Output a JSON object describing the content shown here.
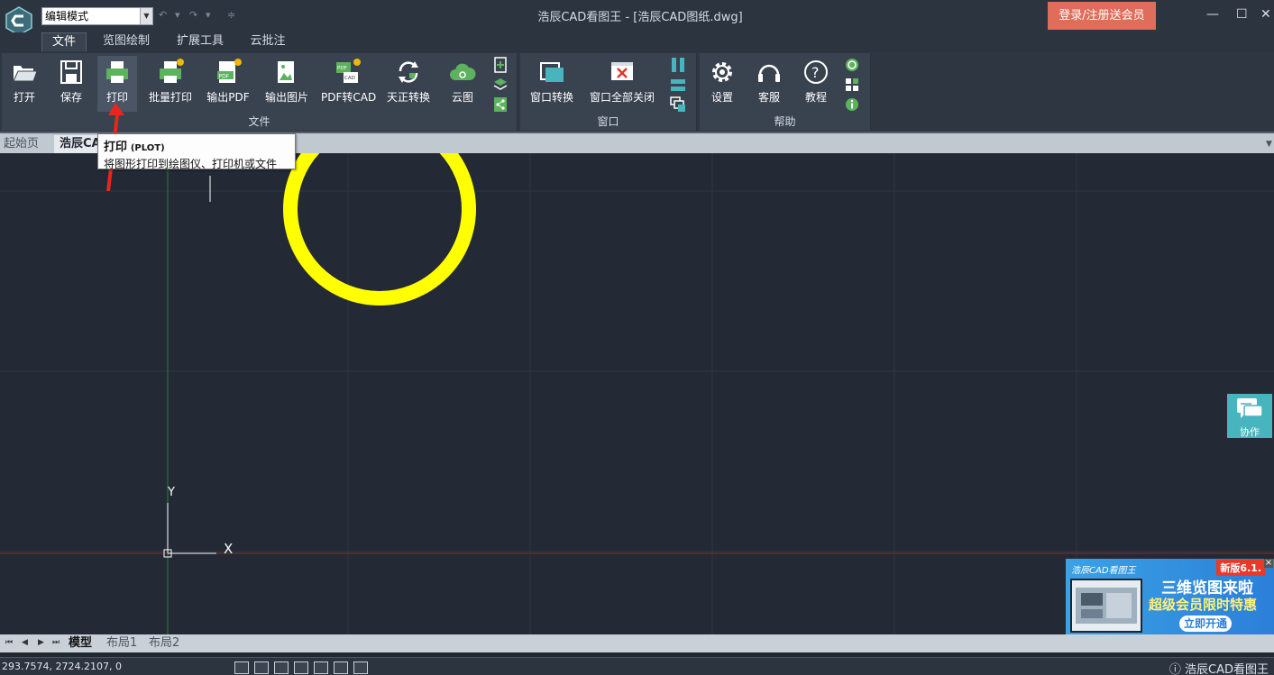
{
  "titlebar": {
    "mode_select": "编辑模式",
    "window_title": "浩辰CAD看图王 - [浩辰CAD图纸.dwg]",
    "login_button": "登录/注册送会员"
  },
  "menu": {
    "tabs": [
      "文件",
      "览图绘制",
      "扩展工具",
      "云批注"
    ]
  },
  "ribbon": {
    "file_group": {
      "label": "文件",
      "buttons": [
        "打开",
        "保存",
        "打印",
        "批量打印",
        "输出PDF",
        "输出图片",
        "PDF转CAD",
        "天正转换",
        "云图"
      ]
    },
    "window_group": {
      "label": "窗口",
      "buttons": [
        "窗口转换",
        "窗口全部关闭"
      ]
    },
    "help_group": {
      "label": "帮助",
      "buttons": [
        "设置",
        "客服",
        "教程"
      ]
    }
  },
  "doc_tabs": {
    "start_page": "起始页",
    "active_doc": "浩辰CA"
  },
  "tooltip": {
    "title": "打印",
    "command": "(PLOT)",
    "description": "将图形打印到绘图仪、打印机或文件"
  },
  "canvas": {
    "ucs_y_label": "Y",
    "ucs_x_label": "X",
    "circle_color": "#ffff00",
    "background_color": "#232a36",
    "y_axis_color": "#2e7d32",
    "x_axis_color": "#8b2a2a"
  },
  "collab": {
    "label": "协作"
  },
  "ad": {
    "brand": "浩辰CAD看图王",
    "badge": "新版6.1.",
    "headline": "三维览图来啦",
    "subline": "超级会员限时特惠",
    "button": "立即开通"
  },
  "layout_tabs": [
    "模型",
    "布局1",
    "布局2"
  ],
  "status": {
    "coordinates": "293.7574, 2724.2107, 0",
    "app_name": "浩辰CAD看图王"
  },
  "colors": {
    "accent_red": "#e06d5a",
    "arrow_red": "#e8261c"
  }
}
